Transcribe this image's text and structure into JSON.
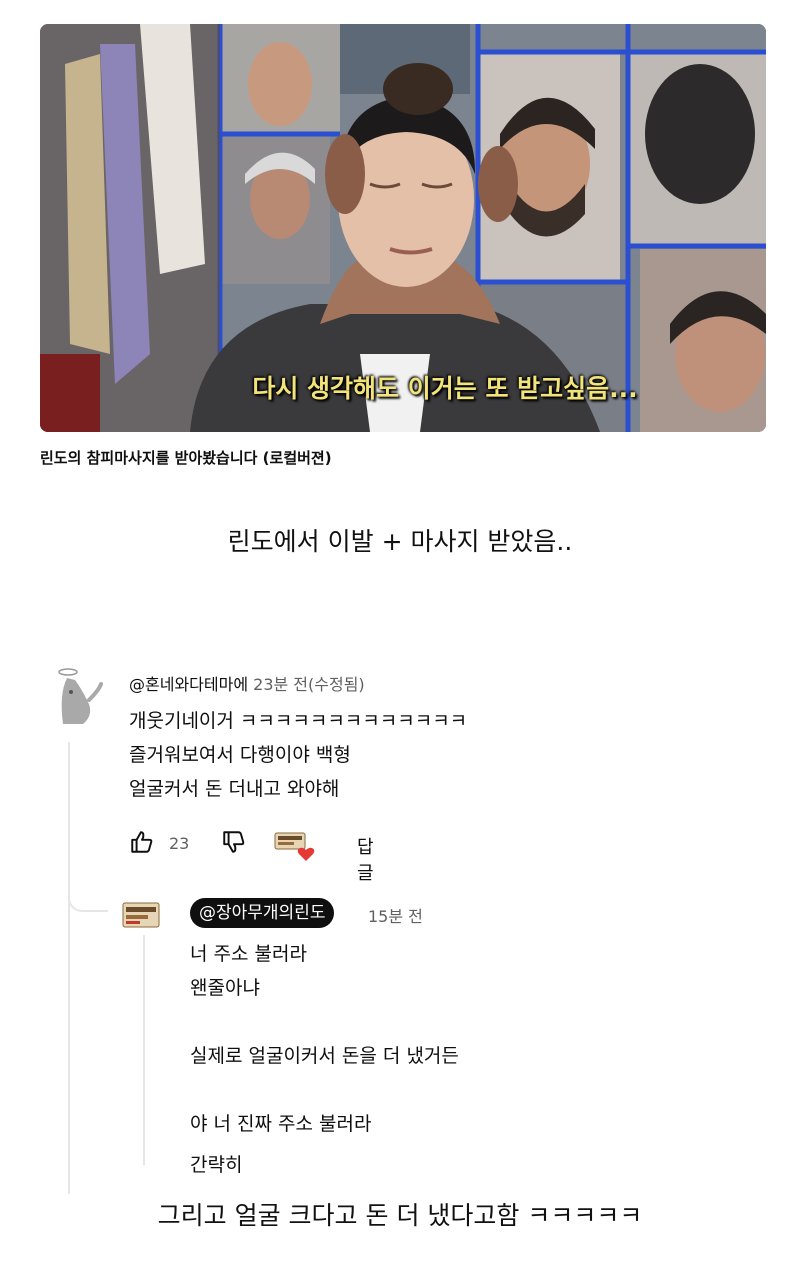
{
  "video": {
    "subtitle": "다시 생각해도 이거는 또 받고싶음...",
    "title": "린도의 참피마사지를 받아봤습니다 (로컬버젼)"
  },
  "caption_top": "린도에서 이발 + 마사지 받았음..",
  "comment": {
    "handle": "@혼네와다테마에",
    "time": "23분 전(수정됨)",
    "lines": [
      "개웃기네이거 ㅋㅋㅋㅋㅋㅋㅋㅋㅋㅋㅋㅋㅋ",
      "즐거워보여서 다행이야 백형",
      "얼굴커서 돈 더내고 와야해"
    ],
    "like_count": "23",
    "reply_label": "답글",
    "icons": [
      "thumbs-up-icon",
      "thumbs-down-icon",
      "creator-heart-icon"
    ],
    "heart_color": "#e53935"
  },
  "reply": {
    "handle": "@장아무개의린도",
    "time": "15분 전",
    "lines": [
      "너 주소 불러라",
      "왠줄아냐",
      "실제로 얼굴이커서 돈을 더 냈거든",
      "야 너 진짜 주소 불러라",
      "간략히"
    ]
  },
  "caption_bottom": "그리고 얼굴 크다고 돈 더 냈다고함 ㅋㅋㅋㅋㅋ"
}
